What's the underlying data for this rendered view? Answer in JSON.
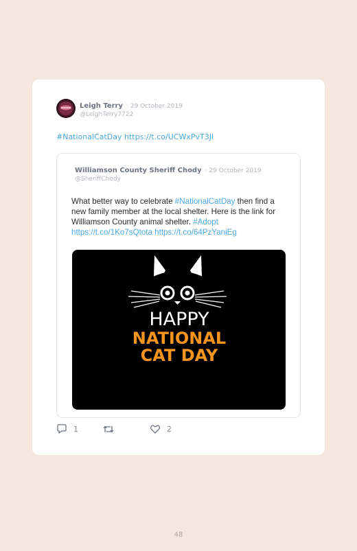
{
  "tweet": {
    "author_name": "Leigh Terry",
    "date": "· 29 October 2019",
    "handle": "@LeighTerry7722",
    "text": "#NationalCatDay https://t.co/UCWxPvT3Jl"
  },
  "quoted": {
    "author_name": "Williamson County Sheriff Chody",
    "date": "· 29 October 2019",
    "handle": "@SheriffChody",
    "text_part1": "What better way to celebrate ",
    "hashtag1": "#NationalCatDay",
    "text_part2": " then find a new family member at the local shelter. Here is the link for Williamson County animal shelter. ",
    "hashtag2": "#Adopt",
    "link1": "https://t.co/1Ko7sQtota",
    "link2": "https://t.co/64PzYaniEg",
    "image": {
      "line1": "HAPPY",
      "line2": "NATIONAL",
      "line3": "CAT DAY"
    }
  },
  "actions": {
    "reply_count": "1",
    "like_count": "2"
  },
  "page_number": "48",
  "colors": {
    "background": "#f5e6de",
    "link": "#4aa8e0",
    "orange": "#f7941d"
  }
}
